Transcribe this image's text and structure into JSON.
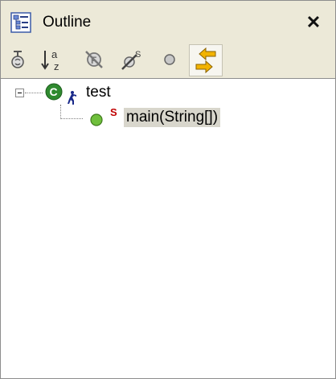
{
  "view": {
    "title": "Outline",
    "title_icon": "outline-view-icon",
    "close_icon": "close-icon",
    "close_glyph": "✕"
  },
  "toolbar": {
    "buttons": [
      {
        "icon": "sort-by-category-icon",
        "pressed": false
      },
      {
        "icon": "sort-alphabetically-icon",
        "pressed": false
      },
      {
        "icon": "hide-fields-icon",
        "pressed": false
      },
      {
        "icon": "hide-static-members-icon",
        "pressed": false
      },
      {
        "icon": "hide-non-public-members-icon",
        "pressed": false
      },
      {
        "icon": "link-with-editor-icon",
        "pressed": true
      }
    ]
  },
  "tree": {
    "class_node": {
      "label": "test",
      "icon": "class-icon",
      "overlay": "runnable-icon",
      "expanded": true
    },
    "method_node": {
      "label": "main(String[])",
      "icon": "public-method-icon",
      "overlay": "static-icon",
      "selected": true
    }
  },
  "colors": {
    "chrome": "#ece9d8",
    "border": "#8d8d8d",
    "class_green": "#2f8a2f",
    "method_green": "#6fbf3c",
    "static_red": "#c00000",
    "runnable_blue": "#1a2a8a",
    "selection": "#d8d6cc"
  }
}
